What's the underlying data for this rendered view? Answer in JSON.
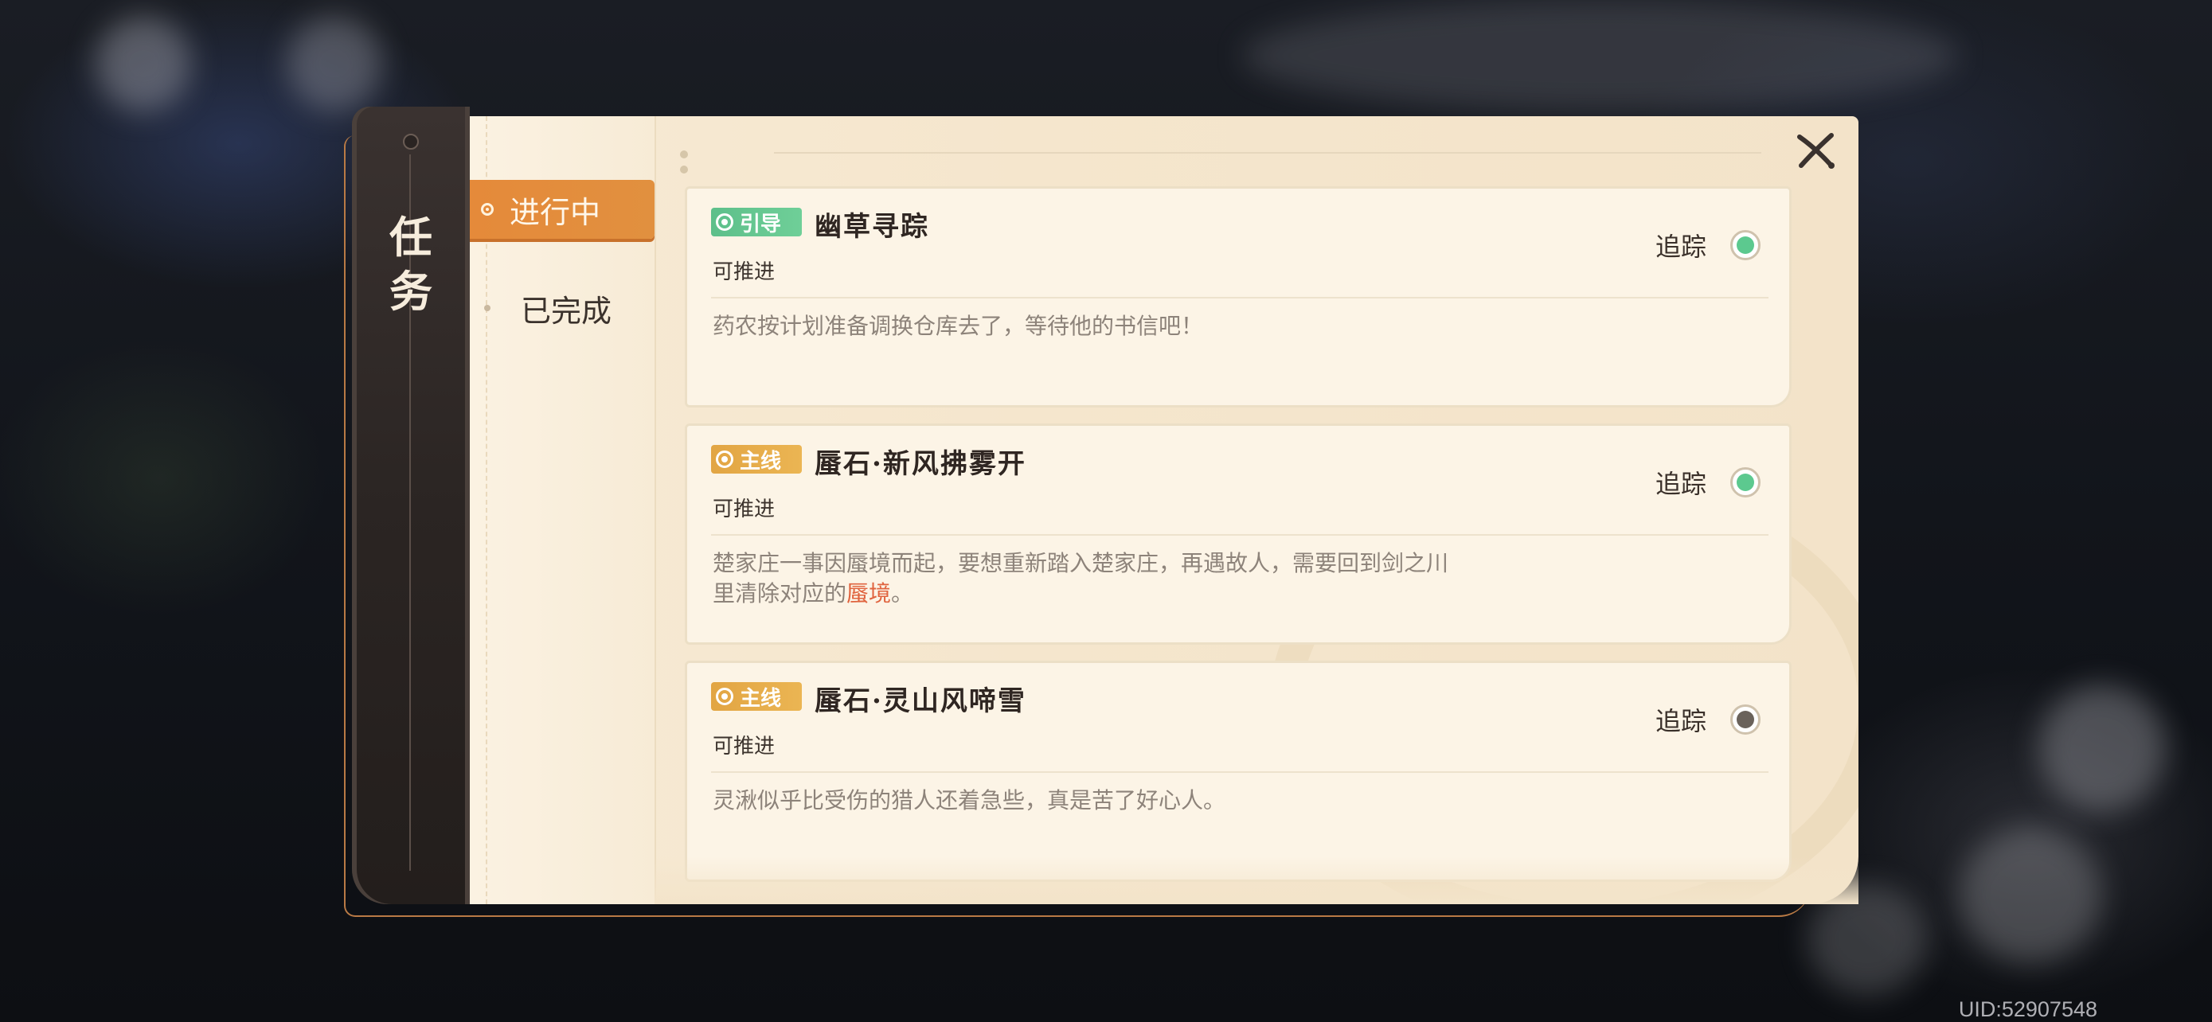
{
  "sidebar": {
    "title_chars": [
      "任",
      "务"
    ]
  },
  "tabs": [
    {
      "label": "进行中",
      "active": true
    },
    {
      "label": "已完成",
      "active": false
    }
  ],
  "quests": [
    {
      "badge": "引导",
      "badge_type": "guide",
      "title": "幽草寻踪",
      "status": "可推进",
      "track_label": "追踪",
      "tracking": true,
      "description": "药农按计划准备调换仓库去了，等待他的书信吧！",
      "description_highlight": "",
      "description_tail": ""
    },
    {
      "badge": "主线",
      "badge_type": "main",
      "title": "蜃石·新风拂雾开",
      "status": "可推进",
      "track_label": "追踪",
      "tracking": true,
      "description": "楚家庄一事因蜃境而起，要想重新踏入楚家庄，再遇故人，需要回到剑之川里清除对应的",
      "description_highlight": "蜃境",
      "description_tail": "。"
    },
    {
      "badge": "主线",
      "badge_type": "main",
      "title": "蜃石·灵山风啼雪",
      "status": "可推进",
      "track_label": "追踪",
      "tracking": false,
      "description": "灵湫似乎比受伤的猎人还着急些，真是苦了好心人。",
      "description_highlight": "",
      "description_tail": ""
    }
  ],
  "uid": "UID:52907548",
  "colors": {
    "accent_orange": "#e58a3a",
    "track_green": "#5cc98f",
    "highlight_red": "#e0643f",
    "badge_guide": "#5dbf8a",
    "badge_main": "#e2a543"
  },
  "icons": {
    "close": "close-icon",
    "tab_active_marker": "radio-dot-icon",
    "badge": "ring-dot-icon"
  }
}
